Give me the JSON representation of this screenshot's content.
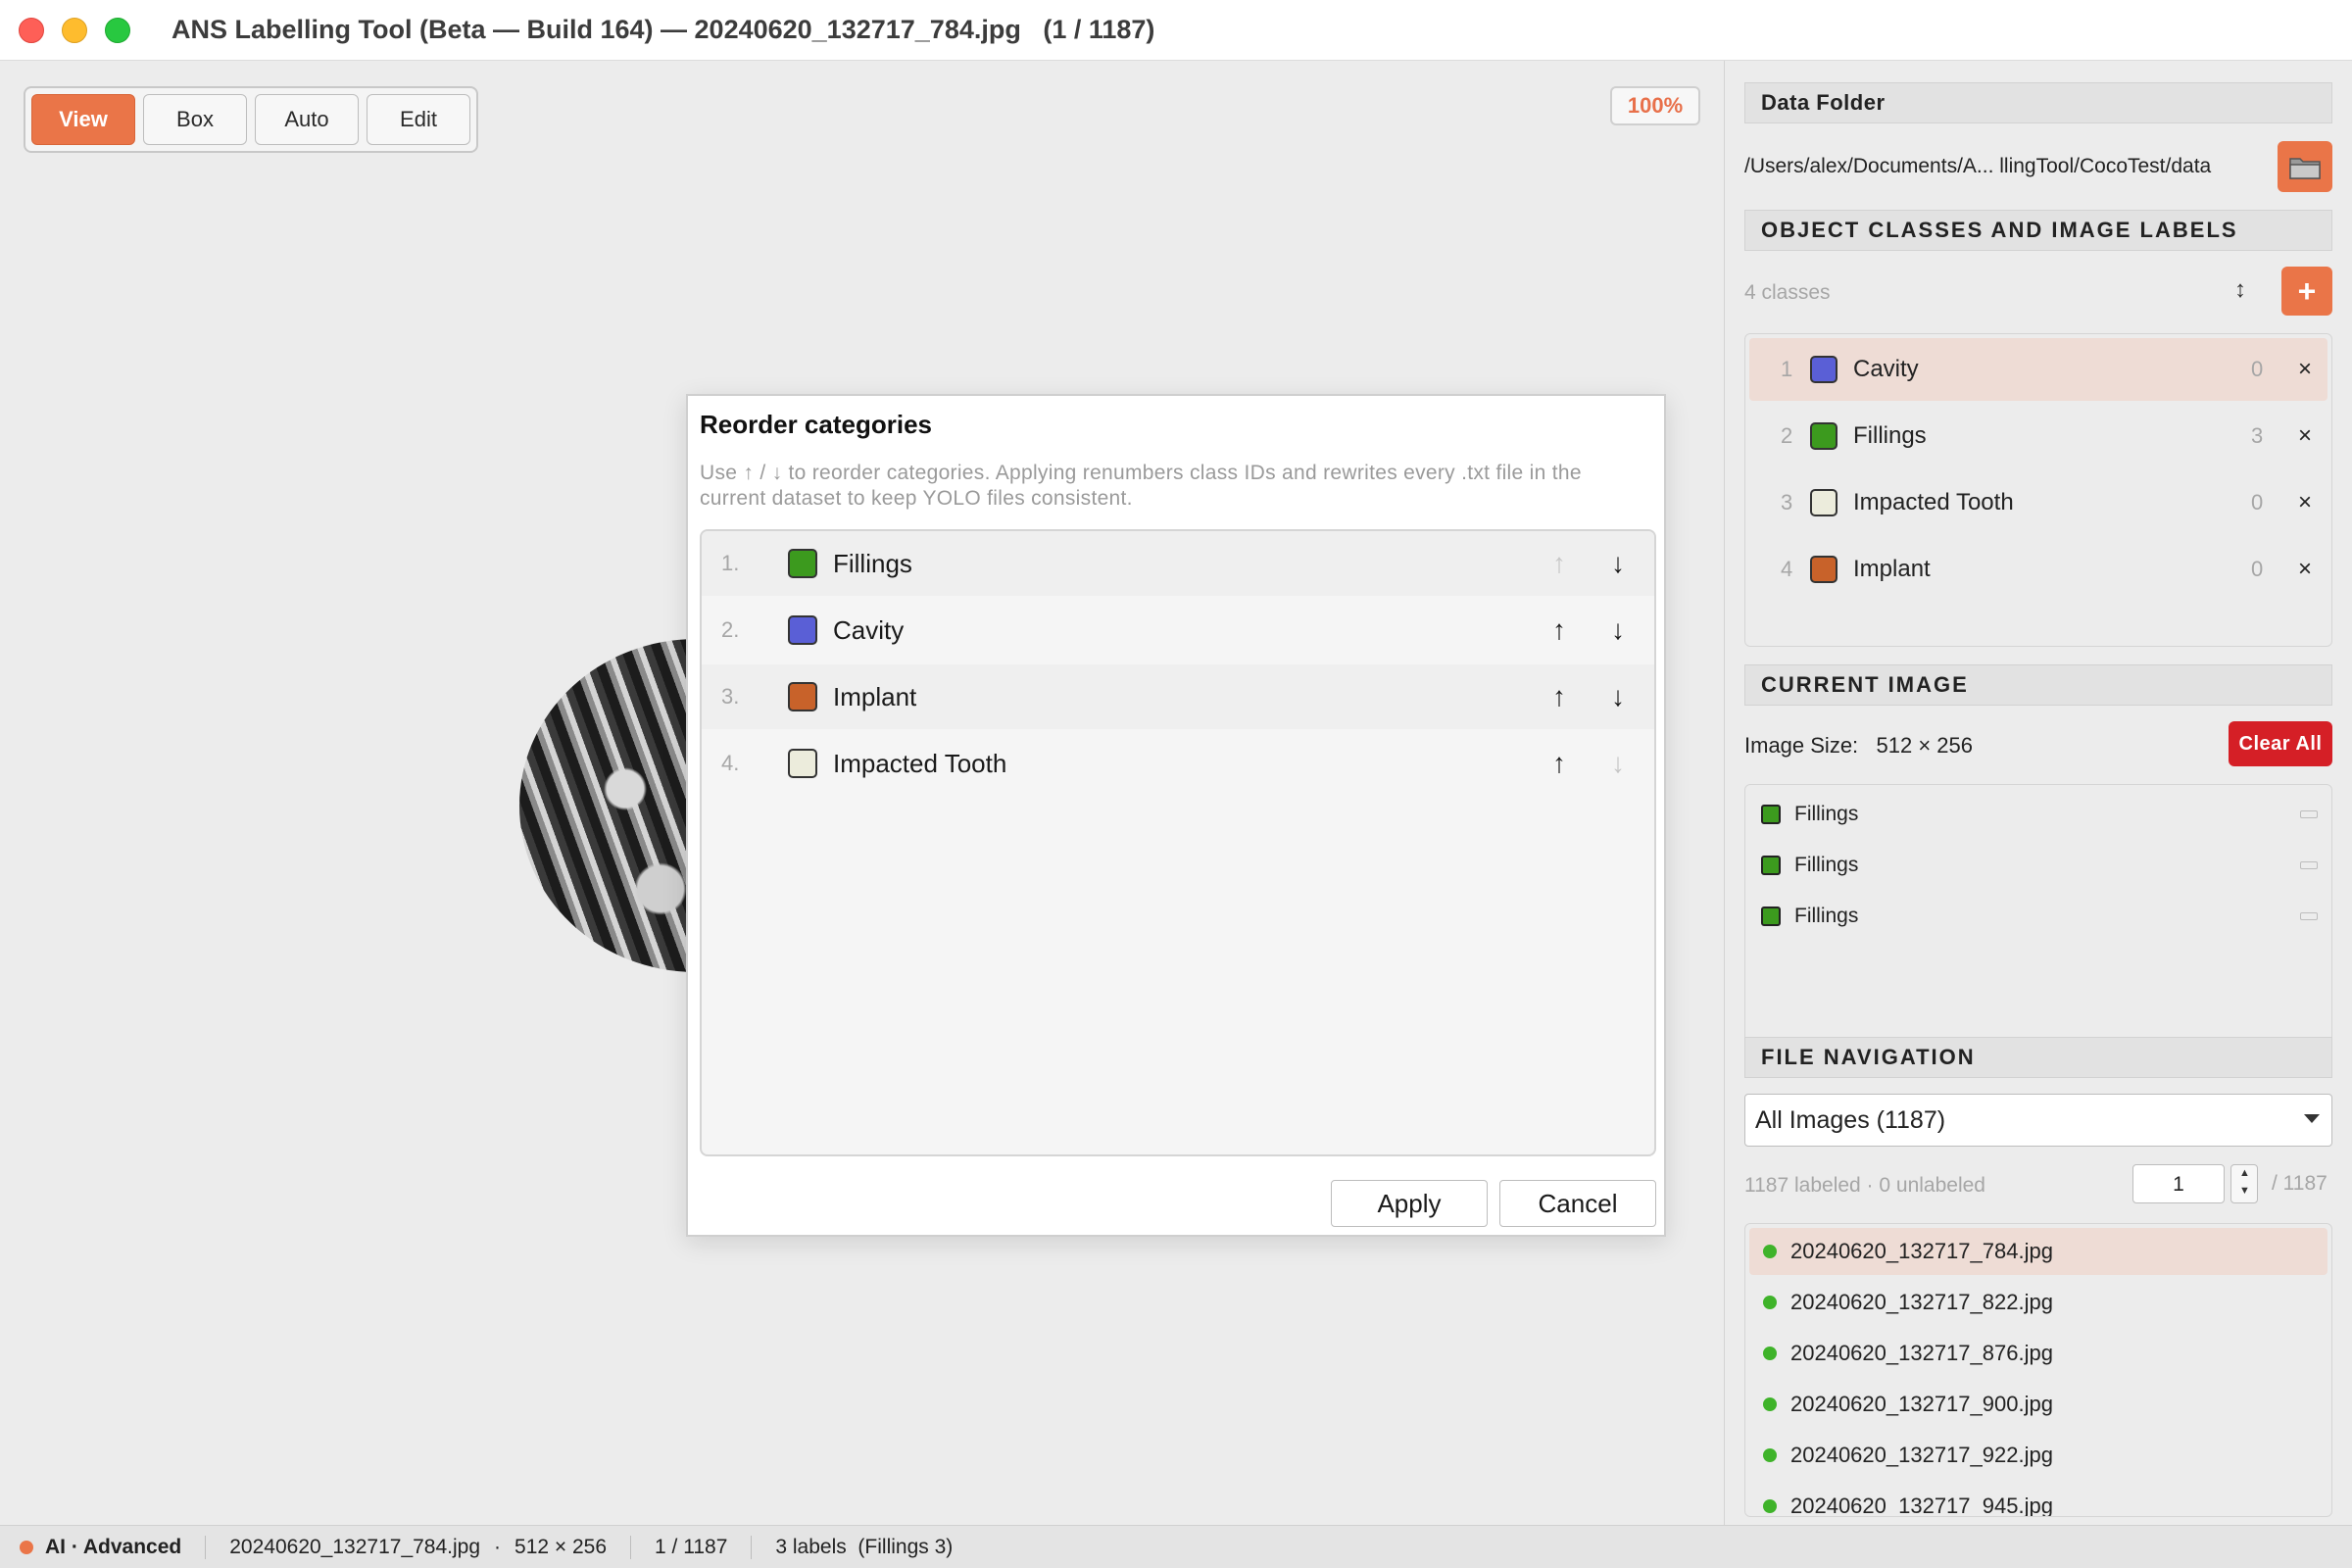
{
  "window": {
    "title": "ANS Labelling Tool (Beta — Build 164) — 20240620_132717_784.jpg   (1 / 1187)"
  },
  "toolbar": {
    "modes": [
      "View",
      "Box",
      "Auto",
      "Edit"
    ],
    "active_mode": "View",
    "zoom": "100%"
  },
  "dialog": {
    "title": "Reorder categories",
    "description": "Use ↑ / ↓ to reorder categories. Applying renumbers class IDs and rewrites every .txt file in the current dataset to keep YOLO files consistent.",
    "items": [
      {
        "num": "1.",
        "name": "Fillings",
        "color": "#3c9a1e"
      },
      {
        "num": "2.",
        "name": "Cavity",
        "color": "#5a5fd6"
      },
      {
        "num": "3.",
        "name": "Implant",
        "color": "#c8622a"
      },
      {
        "num": "4.",
        "name": "Impacted Tooth",
        "color": "#ececdc"
      }
    ],
    "up_icon": "↑",
    "down_icon": "↓",
    "apply_label": "Apply",
    "cancel_label": "Cancel"
  },
  "sidebar": {
    "data_folder": {
      "heading": "Data Folder",
      "path": "/Users/alex/Documents/A... llingTool/CocoTest/data"
    },
    "classes": {
      "heading": "OBJECT CLASSES AND IMAGE LABELS",
      "count_text": "4 classes",
      "sort_icon": "↕",
      "add_label": "+",
      "items": [
        {
          "num": "1",
          "name": "Cavity",
          "count": "0",
          "color": "#5a5fd6"
        },
        {
          "num": "2",
          "name": "Fillings",
          "count": "3",
          "color": "#3c9a1e"
        },
        {
          "num": "3",
          "name": "Impacted Tooth",
          "count": "0",
          "color": "#ececdc"
        },
        {
          "num": "4",
          "name": "Implant",
          "count": "0",
          "color": "#c8622a"
        }
      ],
      "delete_icon": "×"
    },
    "current_image": {
      "heading": "CURRENT IMAGE",
      "size_label": "Image Size:",
      "size_value": "512 × 256",
      "clear_label": "Clear All",
      "labels": [
        {
          "name": "Fillings",
          "color": "#3c9a1e"
        },
        {
          "name": "Fillings",
          "color": "#3c9a1e"
        },
        {
          "name": "Fillings",
          "color": "#3c9a1e"
        }
      ]
    },
    "file_navigation": {
      "heading": "FILE NAVIGATION",
      "filter": "All Images (1187)",
      "stats": "1187 labeled · 0 unlabeled",
      "page": "1",
      "page_total": "/ 1187",
      "files": [
        "20240620_132717_784.jpg",
        "20240620_132717_822.jpg",
        "20240620_132717_876.jpg",
        "20240620_132717_900.jpg",
        "20240620_132717_922.jpg",
        "20240620_132717_945.jpg"
      ]
    }
  },
  "statusbar": {
    "mode": "AI · Advanced",
    "file": "20240620_132717_784.jpg",
    "dot_sep": "·",
    "size": "512 × 256",
    "position": "1 / 1187",
    "labels": "3 labels  (Fillings 3)"
  }
}
